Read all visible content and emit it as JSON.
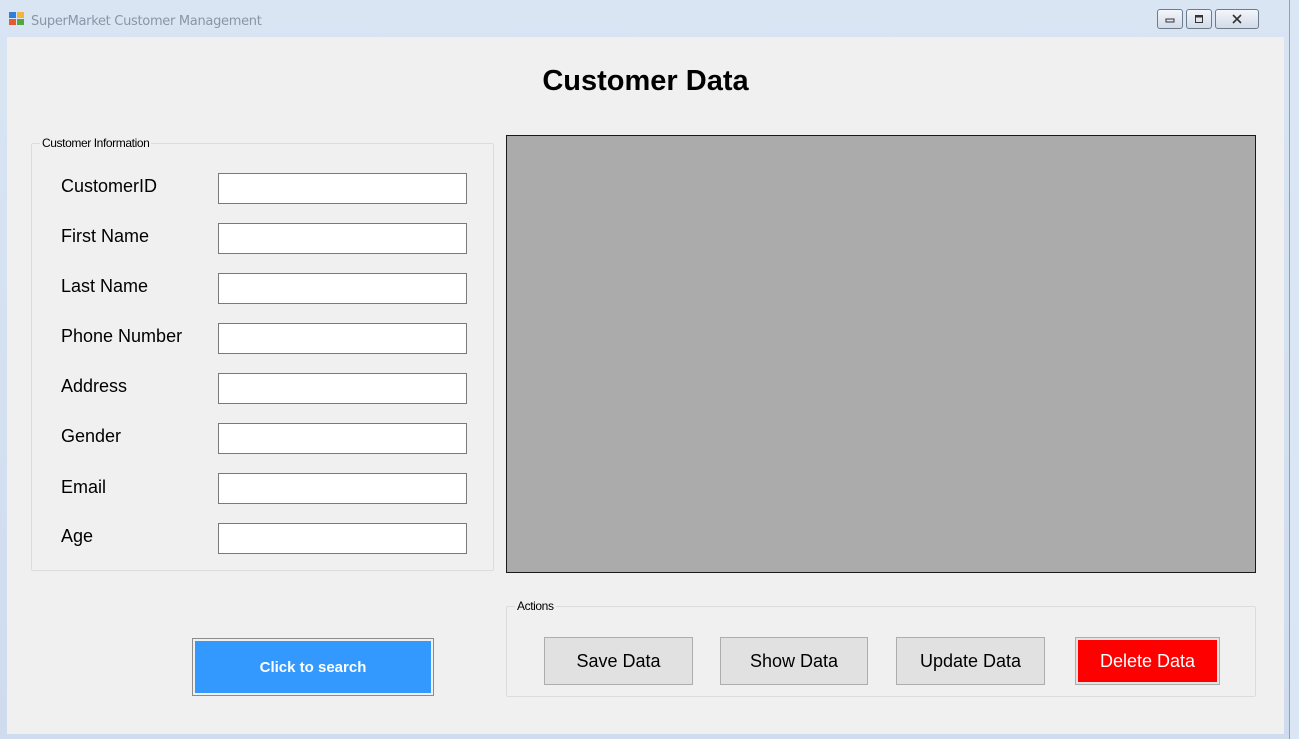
{
  "window": {
    "title": "SuperMarket Customer Management",
    "controls": [
      "minimize-icon",
      "maximize-icon",
      "close-icon"
    ]
  },
  "heading": "Customer Data",
  "customer_info": {
    "legend": "Customer Information",
    "fields": [
      {
        "label": "CustomerID",
        "value": ""
      },
      {
        "label": "First Name",
        "value": ""
      },
      {
        "label": "Last Name",
        "value": ""
      },
      {
        "label": "Phone Number",
        "value": ""
      },
      {
        "label": "Address",
        "value": ""
      },
      {
        "label": "Gender",
        "value": ""
      },
      {
        "label": "Email",
        "value": ""
      },
      {
        "label": "Age",
        "value": ""
      }
    ]
  },
  "search_button": "Click to search",
  "actions": {
    "legend": "Actions",
    "save": "Save Data",
    "show": "Show Data",
    "update": "Update Data",
    "delete": "Delete Data"
  },
  "colors": {
    "search_button": "#3399ff",
    "delete_button": "#ff0000",
    "grid_background": "#ababab"
  }
}
